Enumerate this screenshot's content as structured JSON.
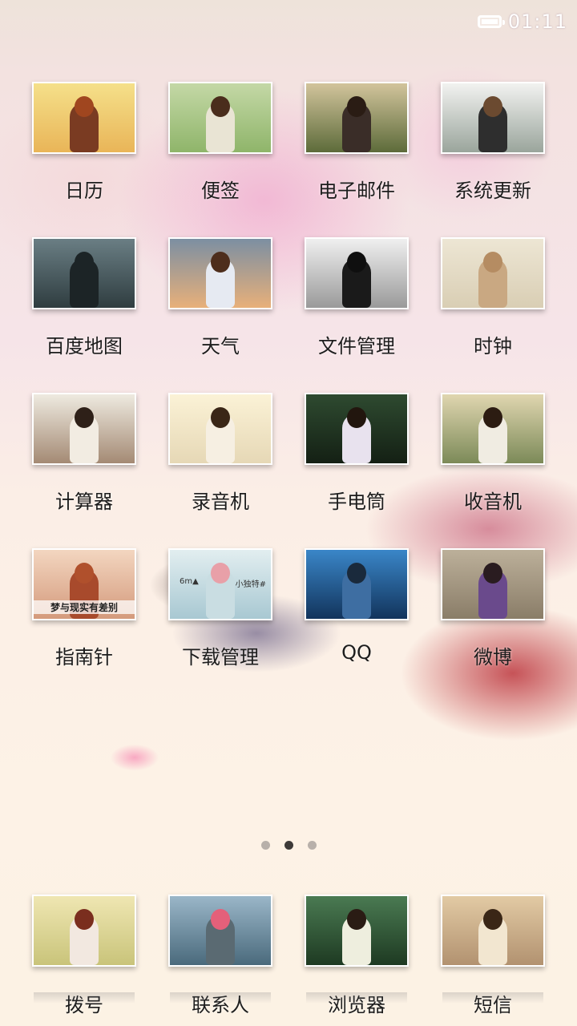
{
  "status_bar": {
    "time": "01:11",
    "battery_icon": "battery-icon"
  },
  "apps": [
    {
      "label": "日历",
      "name": "calendar",
      "thumb": [
        "#f5e08a",
        "#e9b558"
      ],
      "fig": "#7a3b22",
      "hair": "#a0461f"
    },
    {
      "label": "便签",
      "name": "notes",
      "thumb": [
        "#c4d8a6",
        "#8fb56a"
      ],
      "fig": "#e9e4d4",
      "hair": "#4a2d1c"
    },
    {
      "label": "电子邮件",
      "name": "email",
      "thumb": [
        "#d2c49c",
        "#5d6b3a"
      ],
      "fig": "#3a2d28",
      "hair": "#2a1c14"
    },
    {
      "label": "系统更新",
      "name": "system-update",
      "thumb": [
        "#f2f2f0",
        "#9aa59c"
      ],
      "fig": "#2e2e2e",
      "hair": "#6b4a30"
    },
    {
      "label": "百度地图",
      "name": "baidu-map",
      "thumb": [
        "#6a7e84",
        "#2f3d40"
      ],
      "fig": "#1c2426",
      "hair": "#1c2426"
    },
    {
      "label": "天气",
      "name": "weather",
      "thumb": [
        "#7c8fa2",
        "#e8b07a"
      ],
      "fig": "#e6eaf2",
      "hair": "#4e2e1c"
    },
    {
      "label": "文件管理",
      "name": "file-manager",
      "thumb": [
        "#f0f0f0",
        "#9a9a9a"
      ],
      "fig": "#1a1a1a",
      "hair": "#0f0f0f"
    },
    {
      "label": "时钟",
      "name": "clock",
      "thumb": [
        "#ede6d4",
        "#d9ceb4"
      ],
      "fig": "#c9a882",
      "hair": "#b58c62"
    },
    {
      "label": "计算器",
      "name": "calculator",
      "thumb": [
        "#eeeae0",
        "#a48a74"
      ],
      "fig": "#f2ece2",
      "hair": "#2e2018"
    },
    {
      "label": "录音机",
      "name": "voice-recorder",
      "thumb": [
        "#fbf2d6",
        "#e6d8b6"
      ],
      "fig": "#f6efe2",
      "hair": "#3a2616"
    },
    {
      "label": "手电筒",
      "name": "flashlight",
      "thumb": [
        "#2e4a30",
        "#142014"
      ],
      "fig": "#e8e2ee",
      "hair": "#22160e"
    },
    {
      "label": "收音机",
      "name": "radio",
      "thumb": [
        "#e0d6b0",
        "#7c8a58"
      ],
      "fig": "#f0ece2",
      "hair": "#2c1c12"
    },
    {
      "label": "指南针",
      "name": "compass",
      "thumb": [
        "#f3d6c0",
        "#d49a7c"
      ],
      "fig": "#a84a2c",
      "hair": "#b0502c",
      "caption": "梦与现实有差别"
    },
    {
      "label": "下载管理",
      "name": "download-manager",
      "thumb": [
        "#e2eef0",
        "#a8c8d2"
      ],
      "fig": "#c9dde2",
      "hair": "#e8a0a8",
      "caption2": [
        "6m▲",
        "小独特#"
      ]
    },
    {
      "label": "QQ",
      "name": "qq",
      "thumb": [
        "#3a86c8",
        "#12345c"
      ],
      "fig": "#3e6ea2",
      "hair": "#1a2a3c"
    },
    {
      "label": "微博",
      "name": "weibo",
      "thumb": [
        "#bcb09a",
        "#8a7d68"
      ],
      "fig": "#6a4a8c",
      "hair": "#2a1c20"
    }
  ],
  "page_indicator": {
    "count": 3,
    "active": 1
  },
  "dock": [
    {
      "label": "拨号",
      "name": "dialer",
      "thumb": [
        "#efe6b2",
        "#c9c47a"
      ],
      "fig": "#f2e8e0",
      "hair": "#7a2e1e"
    },
    {
      "label": "联系人",
      "name": "contacts",
      "thumb": [
        "#9ab6c8",
        "#4a6a7c"
      ],
      "fig": "#5a6a72",
      "hair": "#e4607a"
    },
    {
      "label": "浏览器",
      "name": "browser",
      "thumb": [
        "#4a7a52",
        "#1e3a22"
      ],
      "fig": "#eeeede",
      "hair": "#2a1c14"
    },
    {
      "label": "短信",
      "name": "messages",
      "thumb": [
        "#e2caa4",
        "#b29270"
      ],
      "fig": "#f2e6d0",
      "hair": "#3a2616"
    }
  ]
}
